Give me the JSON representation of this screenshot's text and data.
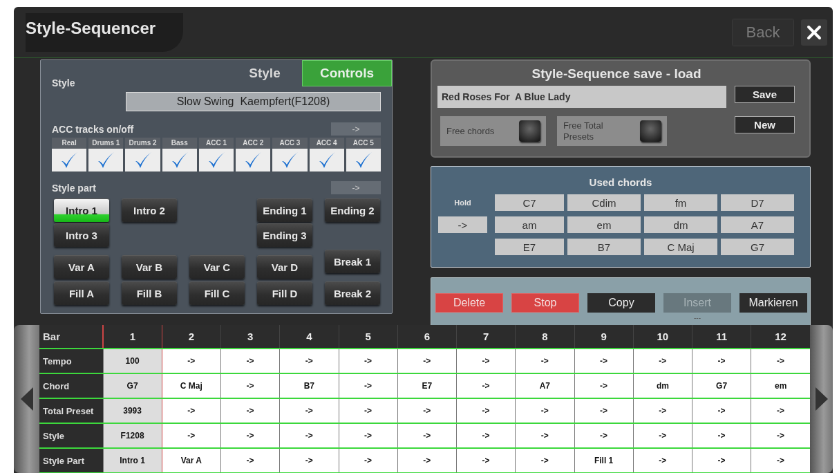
{
  "window": {
    "title": "Style-Sequencer",
    "back_button": {
      "label": "Back",
      "disabled": true
    }
  },
  "style_panel": {
    "style_label": "Style",
    "tabs": [
      {
        "label": "Style",
        "selected": false
      },
      {
        "label": "Controls",
        "selected": true
      }
    ],
    "style_name": "Slow Swing  Kaempfert(F1208)",
    "acc_label": "ACC tracks on/off",
    "acc_arrow": "->",
    "tracks": [
      {
        "label": "Real",
        "checked": true
      },
      {
        "label": "Drums 1",
        "checked": true
      },
      {
        "label": "Drums 2",
        "checked": true
      },
      {
        "label": "Bass",
        "checked": true
      },
      {
        "label": "ACC 1",
        "checked": true
      },
      {
        "label": "ACC 2",
        "checked": true
      },
      {
        "label": "ACC 3",
        "checked": true
      },
      {
        "label": "ACC 4",
        "checked": true
      },
      {
        "label": "ACC 5",
        "checked": true
      }
    ],
    "part_label": "Style part",
    "part_arrow": "->",
    "intros": [
      {
        "label": "Intro 1",
        "selected": true
      },
      {
        "label": "Intro 2",
        "selected": false
      },
      {
        "label": "Intro 3",
        "selected": false
      }
    ],
    "endings": [
      {
        "label": "Ending 1",
        "selected": false
      },
      {
        "label": "Ending 2",
        "selected": false
      },
      {
        "label": "Ending 3",
        "selected": false
      }
    ],
    "variations": [
      {
        "label": "Var A",
        "selected": false
      },
      {
        "label": "Var B",
        "selected": false
      },
      {
        "label": "Var C",
        "selected": false
      },
      {
        "label": "Var D",
        "selected": false
      }
    ],
    "fills": [
      {
        "label": "Fill A",
        "selected": false
      },
      {
        "label": "Fill B",
        "selected": false
      },
      {
        "label": "Fill C",
        "selected": false
      },
      {
        "label": "Fill D",
        "selected": false
      }
    ],
    "breaks": [
      {
        "label": "Break 1",
        "selected": false
      },
      {
        "label": "Break 2",
        "selected": false
      }
    ]
  },
  "sequence_panel": {
    "title": "Style-Sequence save - load",
    "name": "Red Roses For  A Blue Lady",
    "options": [
      {
        "label": "Free chords",
        "checked": false
      },
      {
        "label": "Free Total Presets",
        "checked": false
      }
    ],
    "save_button": "Save",
    "new_button": "New"
  },
  "used_chords": {
    "title": "Used chords",
    "hold_label": "Hold",
    "hold_button": "->",
    "chords": [
      "C7",
      "Cdim",
      "fm",
      "D7",
      "am",
      "em",
      "dm",
      "A7",
      "E7",
      "B7",
      "C Maj",
      "G7"
    ]
  },
  "actions": {
    "buttons": [
      {
        "label": "Delete",
        "kind": "alert",
        "disabled": false
      },
      {
        "label": "Stop",
        "kind": "alert",
        "disabled": false
      },
      {
        "label": "Copy",
        "kind": "plain",
        "disabled": false
      },
      {
        "label": "Insert",
        "kind": "plain",
        "disabled": true
      },
      {
        "label": "Markieren",
        "kind": "plain",
        "disabled": false
      }
    ],
    "insert_marker": "---"
  },
  "table": {
    "header": "Bar",
    "bars": [
      {
        "label": "1",
        "selected": true
      },
      {
        "label": "2",
        "selected": false
      },
      {
        "label": "3",
        "selected": false
      },
      {
        "label": "4",
        "selected": false
      },
      {
        "label": "5",
        "selected": false
      },
      {
        "label": "6",
        "selected": false
      },
      {
        "label": "7",
        "selected": false
      },
      {
        "label": "8",
        "selected": false
      },
      {
        "label": "9",
        "selected": false
      },
      {
        "label": "10",
        "selected": false
      },
      {
        "label": "11",
        "selected": false
      },
      {
        "label": "12",
        "selected": false
      }
    ],
    "rows": [
      {
        "label": "Tempo",
        "cells": [
          "100",
          "->",
          "->",
          "->",
          "->",
          "->",
          "->",
          "->",
          "->",
          "->",
          "->",
          "->"
        ]
      },
      {
        "label": "Chord",
        "cells": [
          "G7",
          "C Maj",
          "->",
          "B7",
          "->",
          "E7",
          "->",
          "A7",
          "->",
          "dm",
          "G7",
          "em"
        ]
      },
      {
        "label": "Total Preset",
        "cells": [
          "3993",
          "->",
          "->",
          "->",
          "->",
          "->",
          "->",
          "->",
          "->",
          "->",
          "->",
          "->"
        ]
      },
      {
        "label": "Style",
        "cells": [
          "F1208",
          "->",
          "->",
          "->",
          "->",
          "->",
          "->",
          "->",
          "->",
          "->",
          "->",
          "->"
        ]
      },
      {
        "label": "Style Part",
        "cells": [
          "Intro 1",
          "Var A",
          "->",
          "->",
          "->",
          "->",
          "->",
          "->",
          "Fill 1",
          "->",
          "->",
          "->"
        ]
      }
    ]
  }
}
